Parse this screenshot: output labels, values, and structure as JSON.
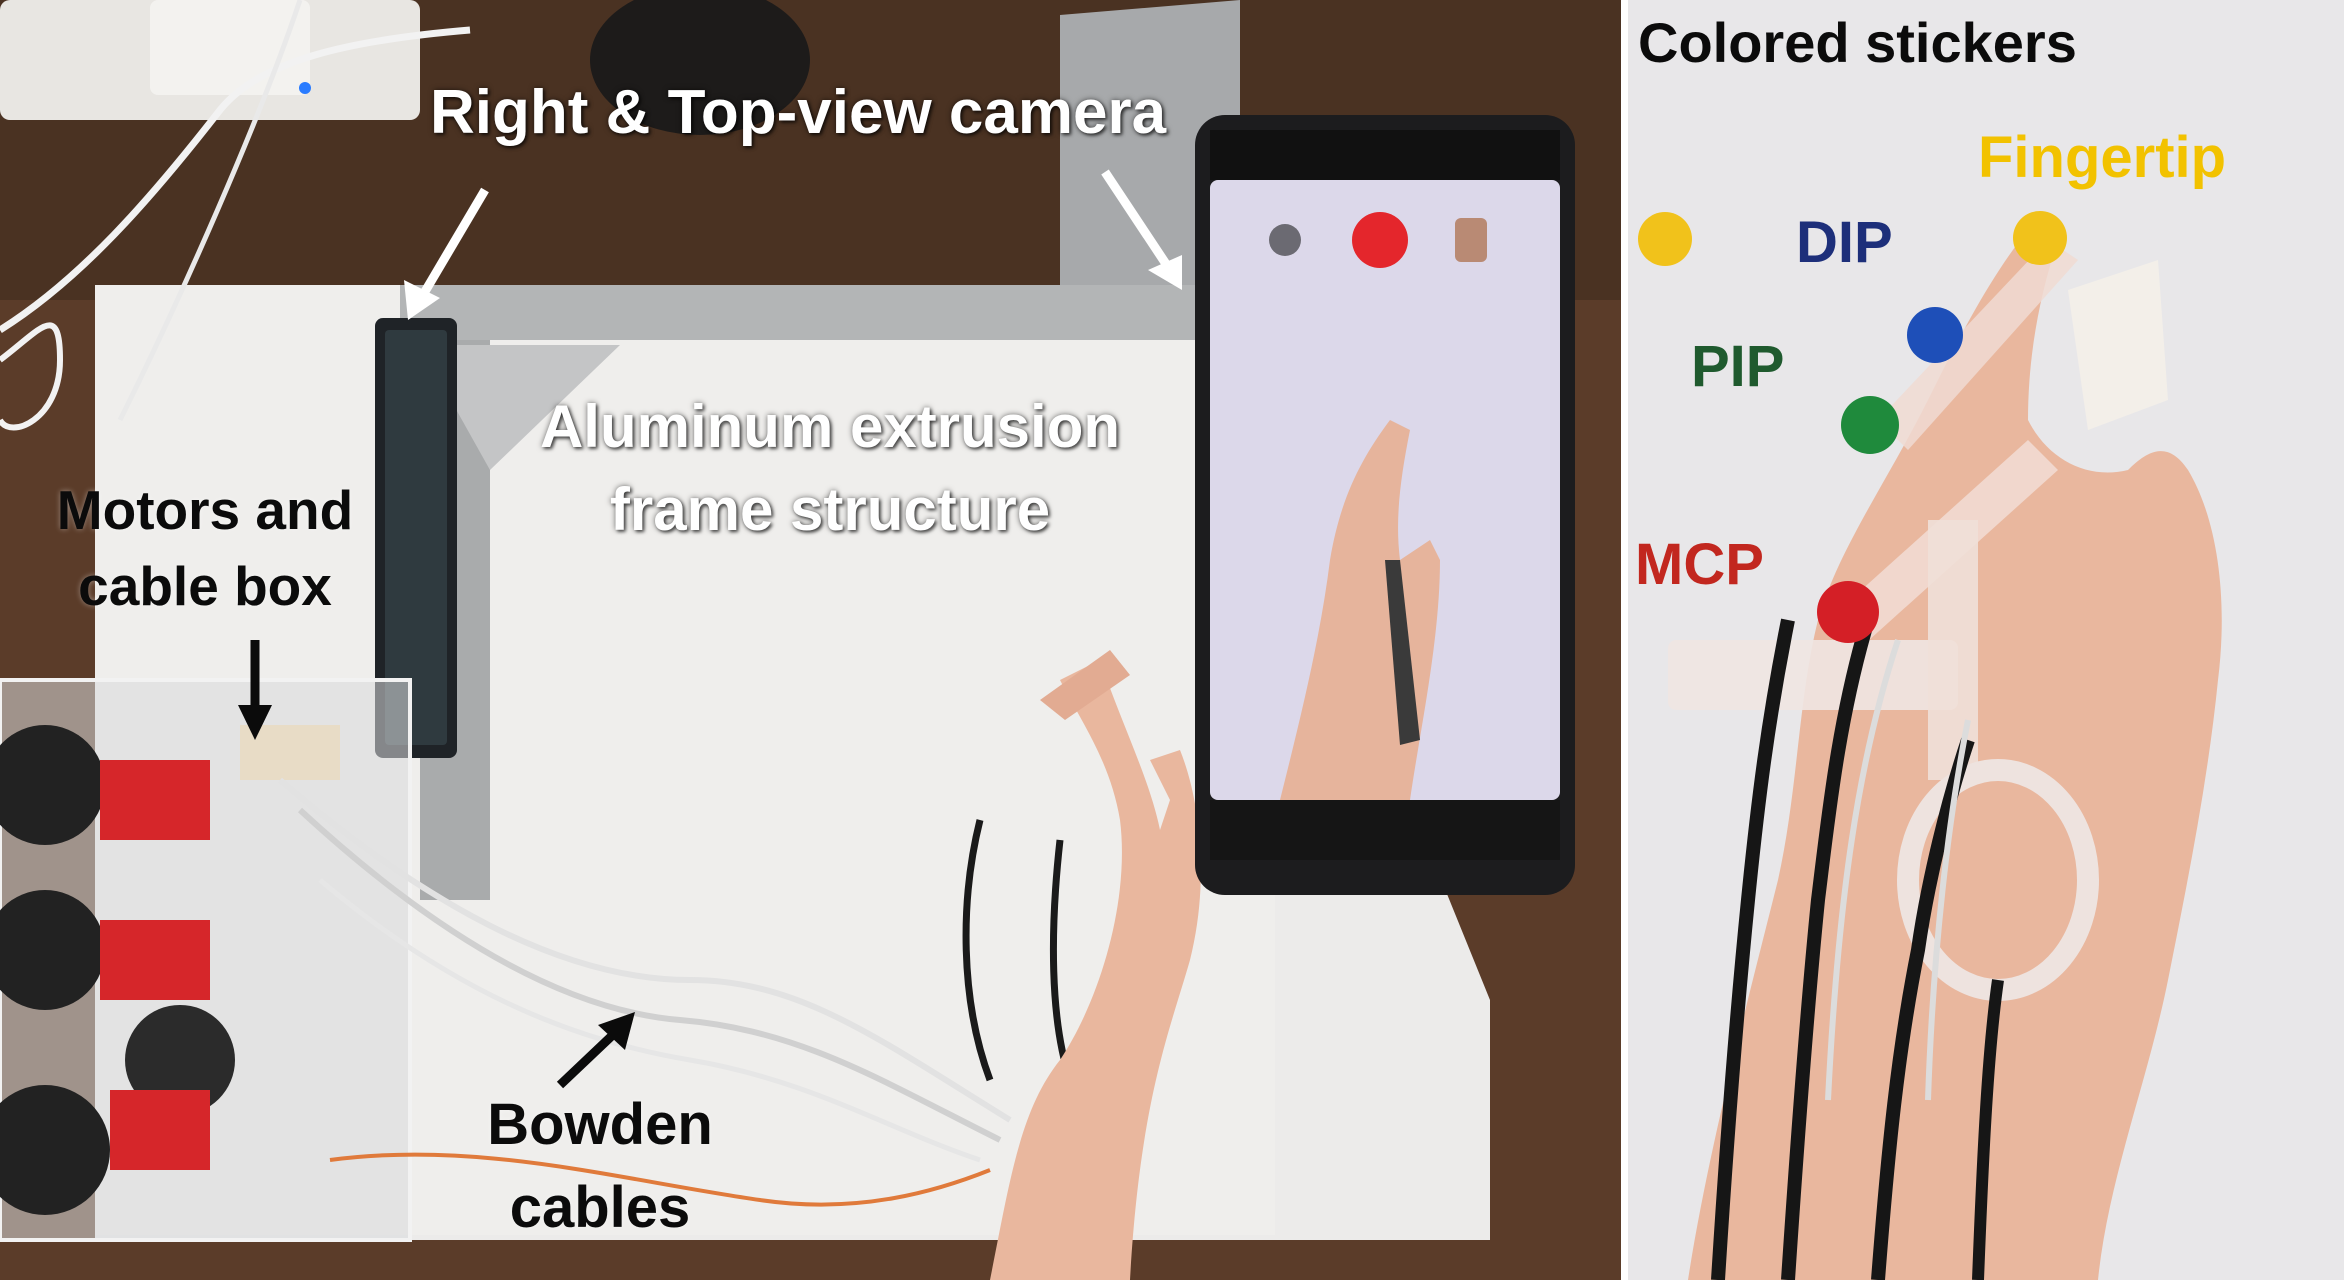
{
  "labels": {
    "camera": "Right & Top-view camera",
    "frame_line1": "Aluminum extrusion",
    "frame_line2": "frame structure",
    "motors_line1": "Motors and",
    "motors_line2": "cable box",
    "bowden_line1": "Bowden",
    "bowden_line2": "cables",
    "stickers_title": "Colored stickers",
    "fingertip": "Fingertip",
    "dip": "DIP",
    "pip": "PIP",
    "mcp": "MCP"
  },
  "colors": {
    "fingertip": "#f2c200",
    "dip": "#1d2f7a",
    "pip": "#1f5a2e",
    "mcp": "#c2271f",
    "sticker_yellow": "#f1c21b",
    "sticker_blue": "#1e4fb8",
    "sticker_green": "#1f8a3c",
    "sticker_red": "#d41f26"
  }
}
